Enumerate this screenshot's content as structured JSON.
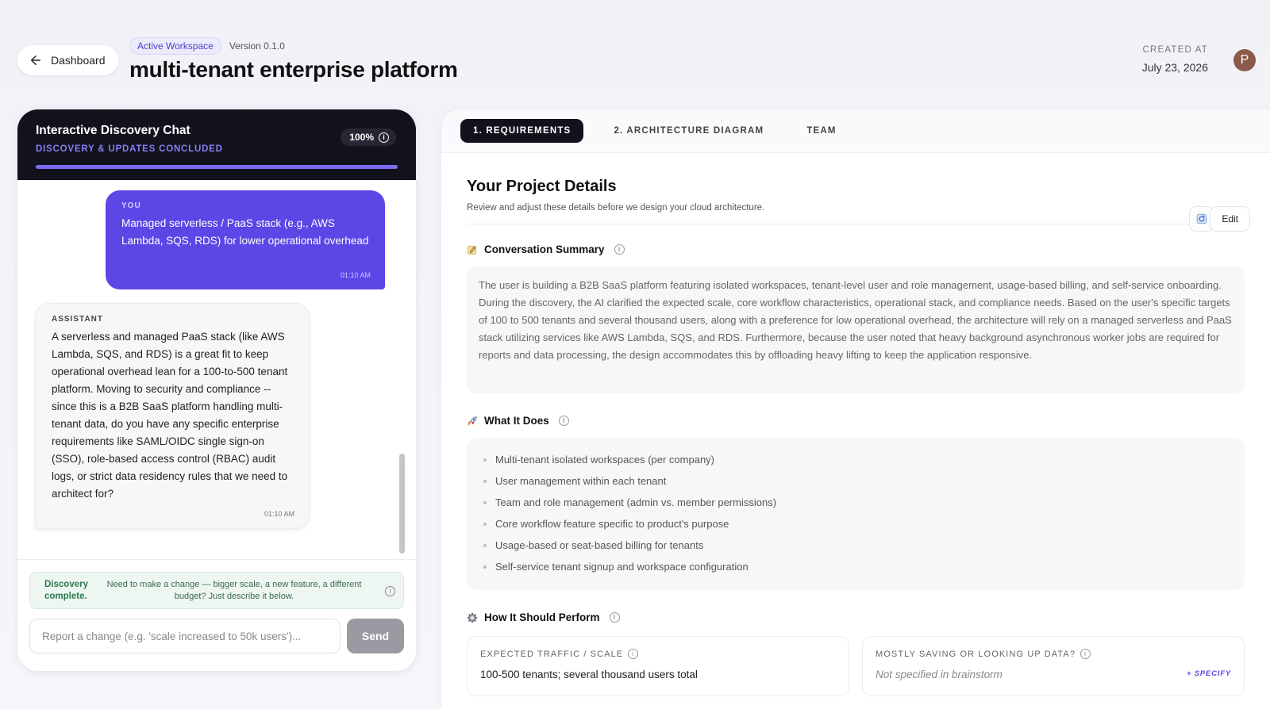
{
  "header": {
    "back_label": "Dashboard",
    "workspace_badge": "Active Workspace",
    "version": "Version 0.1.0",
    "title": "multi-tenant enterprise platform",
    "created_label": "CREATED AT",
    "created_date": "July 23, 2026",
    "avatar_initial": "P"
  },
  "chat": {
    "title": "Interactive Discovery Chat",
    "status": "DISCOVERY & UPDATES CONCLUDED",
    "progress_label": "100%",
    "progress_value": 1.0,
    "messages": [
      {
        "role": "YOU",
        "text": "Managed serverless / PaaS stack (e.g., AWS Lambda, SQS, RDS) for lower operational overhead",
        "time": "01:10 AM"
      },
      {
        "role": "ASSISTANT",
        "text": "A serverless and managed PaaS stack (like AWS Lambda, SQS, and RDS) is a great fit to keep operational overhead lean for a 100-to-500 tenant platform. Moving to security and compliance -- since this is a B2B SaaS platform handling multi-tenant data, do you have any specific enterprise requirements like SAML/OIDC single sign-on (SSO), role-based access control (RBAC) audit logs, or strict data residency rules that we need to architect for?",
        "time": "01:10 AM"
      }
    ],
    "notice_title": "Discovery complete.",
    "notice_text": "Need to make a change — bigger scale, a new feature, a different budget? Just describe it below.",
    "input_placeholder": "Report a change (e.g. 'scale increased to 50k users')...",
    "send_label": "Send"
  },
  "tabs": [
    {
      "label": "1. REQUIREMENTS",
      "active": true
    },
    {
      "label": "2. ARCHITECTURE DIAGRAM",
      "active": false
    },
    {
      "label": "TEAM",
      "active": false
    }
  ],
  "details": {
    "title": "Your Project Details",
    "subtitle": "Review and adjust these details before we design your cloud architecture.",
    "edit_label": "Edit",
    "summary_heading": "Conversation Summary",
    "summary_text": "The user is building a B2B SaaS platform featuring isolated workspaces, tenant-level user and role management, usage-based billing, and self-service onboarding. During the discovery, the AI clarified the expected scale, core workflow characteristics, operational stack, and compliance needs. Based on the user's specific targets of 100 to 500 tenants and several thousand users, along with a preference for low operational overhead, the architecture will rely on a managed serverless and PaaS stack utilizing services like AWS Lambda, SQS, and RDS. Furthermore, because the user noted that heavy background asynchronous worker jobs are required for reports and data processing, the design accommodates this by offloading heavy lifting to keep the application responsive.",
    "does_heading": "What It Does",
    "does_items": [
      "Multi-tenant isolated workspaces (per company)",
      "User management within each tenant",
      "Team and role management (admin vs. member permissions)",
      "Core workflow feature specific to product's purpose",
      "Usage-based or seat-based billing for tenants",
      "Self-service tenant signup and workspace configuration"
    ],
    "perform_heading": "How It Should Perform",
    "perf_cards": [
      {
        "label": "EXPECTED TRAFFIC / SCALE",
        "value": "100-500 tenants; several thousand users total"
      },
      {
        "label": "MOSTLY SAVING OR LOOKING UP DATA?",
        "value": "Not specified in brainstorm",
        "action": "+ SPECIFY"
      }
    ]
  },
  "colors": {
    "accent": "#5a47e6",
    "dark": "#11121c",
    "success": "#2a7a4f"
  },
  "icons": {
    "back": "arrow-left-icon",
    "info": "info-icon",
    "refresh": "refresh-icon",
    "summary": "memo-icon",
    "does": "rocket-icon",
    "perform": "gear-icon"
  }
}
